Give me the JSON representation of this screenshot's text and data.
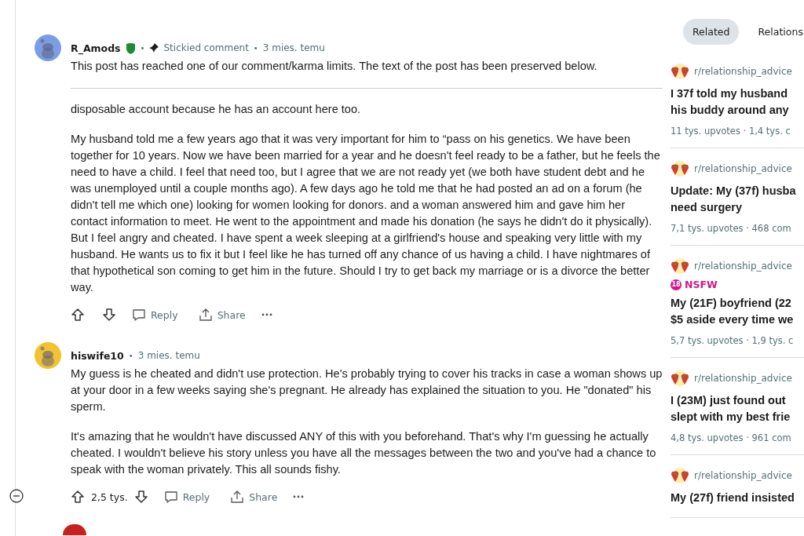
{
  "comments": [
    {
      "author": "R_Amods",
      "color": "#7b9de6",
      "moderator": true,
      "separators": [
        "•",
        "•"
      ],
      "stickied_label": "Stickied comment",
      "time": "3 mies. temu",
      "collapsible": false,
      "notice": "This post has reached one of our comment/karma limits. The text of the post has been preserved below.",
      "paragraphs": [
        "disposable account because he has an account here too.",
        "My husband told me a few years ago that it was very important for him to “pass on his genetics. We have been together for 10 years. Now we have been married for a year and he doesn't feel ready to be a father, but he feels the need to have a child. I feel that need too, but I agree that we are not ready yet (we both have student debt and he was unemployed until a couple months ago). A few days ago he told me that he had posted an ad on a forum (he didn't tell me which one) looking for women looking for donors. and a woman answered him and gave him her contact information to meet. He went to the appointment and made his donation (he says he didn't do it physically). But I feel angry and cheated. I have spent a week sleeping at a girlfriend's house and speaking very little with my husband. He wants us to fix it but I feel like he has turned off any chance of us having a child. I have nightmares of that hypothetical son coming to get him in the future. Should I try to get back my marriage or is a divorce the better way."
      ],
      "actions": {
        "reply": "Reply",
        "share": "Share"
      }
    },
    {
      "author": "hiswife10",
      "color": "#f2c230",
      "moderator": false,
      "separators": [
        "•"
      ],
      "time": "3 mies. temu",
      "collapsible": true,
      "paragraphs": [
        "My guess is he cheated and didn't use protection. He's probably trying to cover his tracks in case a woman shows up at your door in a few weeks saying she's pregnant. He already has explained the situation to you. He \"donated\" his sperm.",
        "It's amazing that he wouldn't have discussed ANY of this with you beforehand. That's why I'm guessing he actually cheated. I wouldn't believe his story unless you have all the messages between the two and you've had a chance to speak with the woman privately. This all sounds fishy."
      ],
      "actions": {
        "score": "2,5 tys.",
        "reply": "Reply",
        "share": "Share"
      }
    }
  ],
  "sidebar": {
    "tabs": [
      {
        "label": "Related",
        "selected": true
      },
      {
        "label": "Relations",
        "selected": false
      }
    ],
    "posts": [
      {
        "subreddit": "r/relationship_advice",
        "title_lines": [
          "I 37f told my husband",
          "his buddy around any"
        ],
        "meta": "11 tys. upvotes · 1,4 tys. c"
      },
      {
        "subreddit": "r/relationship_advice",
        "title_lines": [
          "Update: My (37f) husba",
          "need surgery"
        ],
        "meta": "7,1 tys. upvotes · 468 com"
      },
      {
        "subreddit": "r/relationship_advice",
        "nsfw": {
          "age": "18",
          "label": "NSFW"
        },
        "title_lines": [
          "My (21F) boyfriend (22",
          "$5 aside every time we"
        ],
        "meta": "5,7 tys. upvotes · 1,9 tys. c"
      },
      {
        "subreddit": "r/relationship_advice",
        "title_lines": [
          "I (23M) just found out",
          "slept with my best frie"
        ],
        "meta": "4,8 tys. upvotes · 961 com"
      },
      {
        "subreddit": "r/relationship_advice",
        "title_lines": [
          "My (27f) friend insisted"
        ]
      }
    ]
  }
}
